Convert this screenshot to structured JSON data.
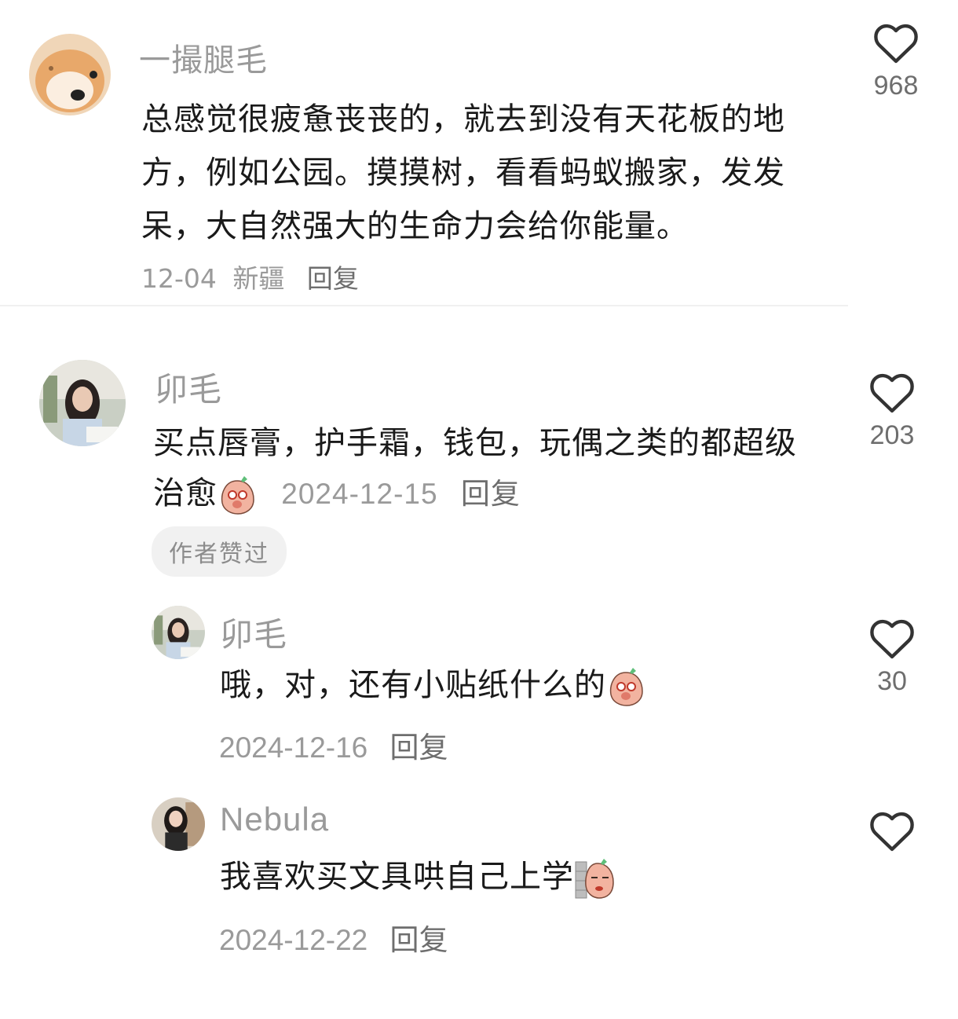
{
  "comments": [
    {
      "username": "一撮腿毛",
      "text": "总感觉很疲惫丧丧的，就去到没有天花板的地方，例如公园。摸摸树，看看蚂蚁搬家，发发呆，大自然强大的生命力会给你能量。",
      "date": "12-04",
      "location": "新疆",
      "reply_label": "回复",
      "likes": "968",
      "avatar_icon": "shiba-dog-avatar"
    },
    {
      "username": "卯毛",
      "text": "买点唇膏，护手霜，钱包，玩偶之类的都超级治愈",
      "emoji_icon": "blushing-peach-emoji",
      "date": "2024-12-15",
      "reply_label": "回复",
      "likes": "203",
      "badge": "作者赞过",
      "avatar_icon": "girl-photo-avatar"
    },
    {
      "username": "卯毛",
      "text": "哦，对，还有小贴纸什么的",
      "emoji_icon": "blushing-peach-emoji",
      "date": "2024-12-16",
      "reply_label": "回复",
      "likes": "30",
      "avatar_icon": "girl-photo-avatar"
    },
    {
      "username": "Nebula",
      "text": "我喜欢买文具哄自己上学",
      "emoji_icon": "peeking-peach-emoji",
      "date": "2024-12-22",
      "reply_label": "回复",
      "likes": "",
      "avatar_icon": "woman-photo-avatar"
    }
  ],
  "colors": {
    "username": "#9a9a9a",
    "text": "#1a1a1a",
    "meta": "#9a9a9a",
    "badge_bg": "#f1f1f1"
  }
}
